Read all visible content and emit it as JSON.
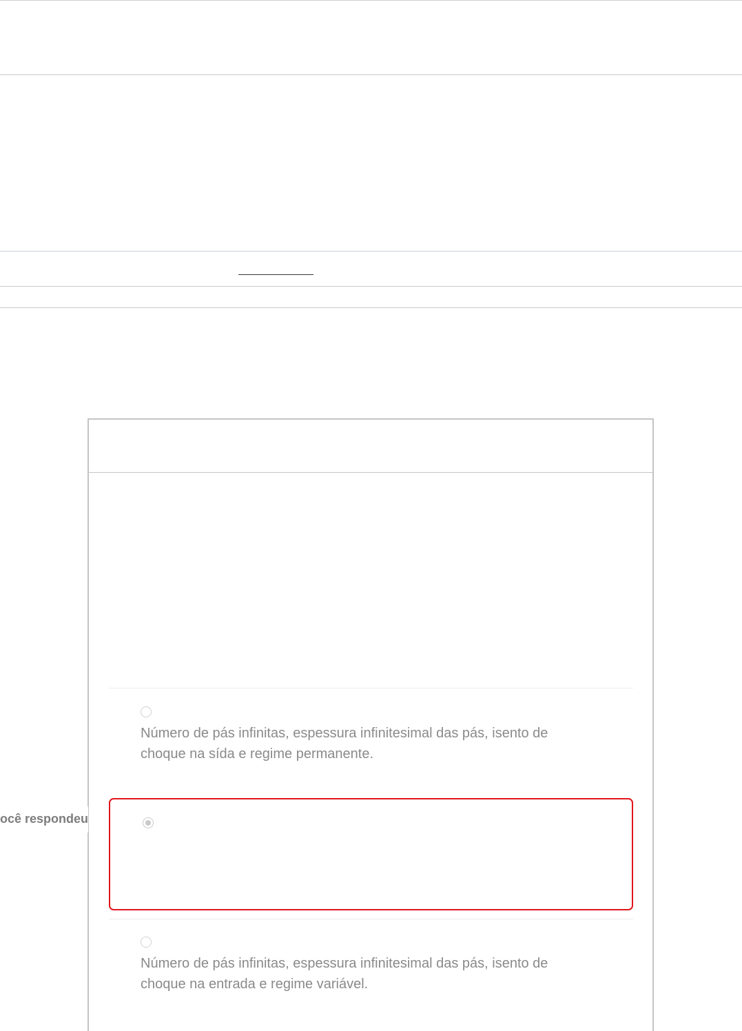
{
  "answered_label": "ocê respondeu",
  "options": [
    {
      "text_line1": "Número de pás infinitas, espessura infinitesimal das pás, isento de",
      "text_line2": "choque na sída e regime permanente.",
      "selected": false
    },
    {
      "text_line1": "",
      "text_line2": "",
      "selected": true
    },
    {
      "text_line1": "Número de pás infinitas, espessura infinitesimal das pás, isento de",
      "text_line2": "choque na entrada e regime variável.",
      "selected": false
    }
  ],
  "colors": {
    "highlight_border": "#e0151b",
    "text": "#8a8a8a",
    "divider": "#c8c8c8"
  }
}
